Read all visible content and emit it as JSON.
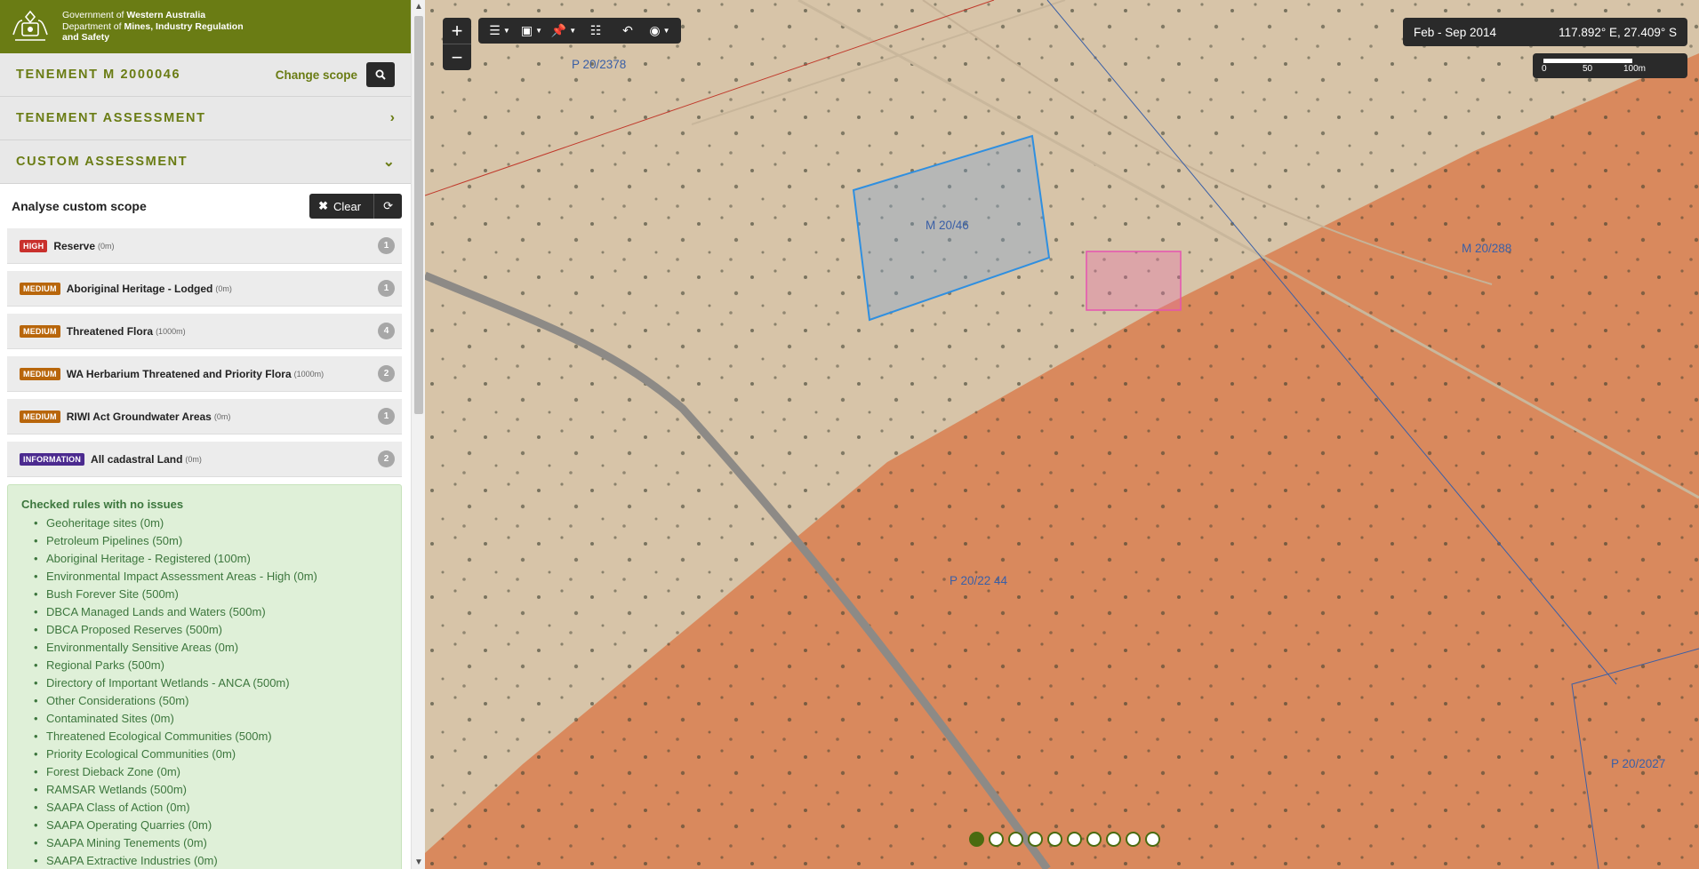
{
  "brand": {
    "line1_prefix": "Government of ",
    "line1_bold": "Western Australia",
    "line2_prefix": "Department of ",
    "line2_bold": "Mines, Industry Regulation",
    "line3_bold": "and Safety"
  },
  "scope": {
    "title": "TENEMENT M 2000046",
    "change_label": "Change scope",
    "search_icon": "search-icon"
  },
  "sections": {
    "tenement_assessment": "TENEMENT ASSESSMENT",
    "custom_assessment": "CUSTOM ASSESSMENT"
  },
  "custom": {
    "title": "Analyse custom scope",
    "clear_label": "Clear"
  },
  "rules": [
    {
      "level": "HIGH",
      "color": "#c9302c",
      "name": "Reserve",
      "dist": "(0m)",
      "count": "1"
    },
    {
      "level": "MEDIUM",
      "color": "#b8660b",
      "name": "Aboriginal Heritage - Lodged",
      "dist": "(0m)",
      "count": "1"
    },
    {
      "level": "MEDIUM",
      "color": "#b8660b",
      "name": "Threatened Flora",
      "dist": "(1000m)",
      "count": "4"
    },
    {
      "level": "MEDIUM",
      "color": "#b8660b",
      "name": "WA Herbarium Threatened and Priority Flora",
      "dist": "(1000m)",
      "count": "2"
    },
    {
      "level": "MEDIUM",
      "color": "#b8660b",
      "name": "RIWI Act Groundwater Areas",
      "dist": "(0m)",
      "count": "1"
    },
    {
      "level": "INFORMATION",
      "color": "#4b2a8f",
      "name": "All cadastral Land",
      "dist": "(0m)",
      "count": "2"
    }
  ],
  "no_issues": {
    "title": "Checked rules with no issues",
    "items": [
      "Geoheritage sites (0m)",
      "Petroleum Pipelines (50m)",
      "Aboriginal Heritage - Registered (100m)",
      "Environmental Impact Assessment Areas - High (0m)",
      "Bush Forever Site (500m)",
      "DBCA Managed Lands and Waters (500m)",
      "DBCA Proposed Reserves (500m)",
      "Environmentally Sensitive Areas (0m)",
      "Regional Parks (500m)",
      "Directory of Important Wetlands - ANCA (500m)",
      "Other Considerations (50m)",
      "Contaminated Sites (0m)",
      "Threatened Ecological Communities (500m)",
      "Priority Ecological Communities (0m)",
      "Forest Dieback Zone (0m)",
      "RAMSAR Wetlands (500m)",
      "SAAPA Class of Action (0m)",
      "SAAPA Operating Quarries (0m)",
      "SAAPA Mining Tenements (0m)",
      "SAAPA Extractive Industries (0m)"
    ]
  },
  "map": {
    "date_range": "Feb - Sep 2014",
    "coords": "117.892° E, 27.409° S",
    "scale": {
      "t0": "0",
      "t1": "50",
      "t2": "100m"
    },
    "labels": {
      "p2378": "P 20/2378",
      "m2046": "M 20/46",
      "m20288": "M 20/288",
      "p2244": "P 20/22 44",
      "p2027": "P 20/2027"
    },
    "pager_count": 10,
    "pager_active": 0
  },
  "colors": {
    "brand": "#6a7c14",
    "dark_control": "#2a2a2a",
    "success_bg": "#dff0d8"
  }
}
